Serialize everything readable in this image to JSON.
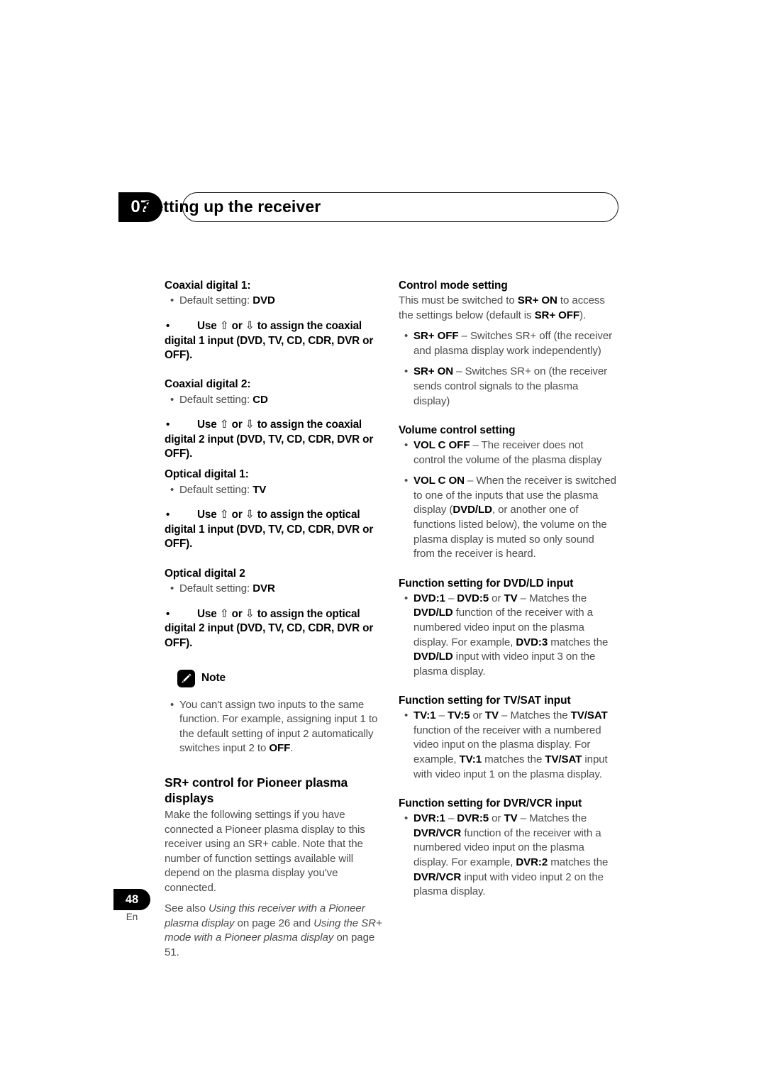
{
  "header": {
    "chapter_number": "07",
    "title": "Setting up the receiver"
  },
  "footer": {
    "page_number": "48",
    "language": "En"
  },
  "left_column": {
    "coaxial1": {
      "heading": "Coaxial digital 1:",
      "default": "Default setting: ",
      "default_value": "DVD",
      "instruction_pre": "Use ",
      "instruction_mid": " or ",
      "instruction_post": " to assign the coaxial digital 1 input (DVD, TV, CD, CDR, DVR or OFF)."
    },
    "coaxial2": {
      "heading": "Coaxial digital 2:",
      "default": "Default setting: ",
      "default_value": "CD",
      "instruction_pre": "Use ",
      "instruction_mid": " or ",
      "instruction_post": " to assign the coaxial digital 2 input (DVD, TV, CD, CDR, DVR or OFF)."
    },
    "optical1": {
      "heading": "Optical digital 1:",
      "default": "Default setting: ",
      "default_value": "TV",
      "instruction_pre": "Use ",
      "instruction_mid": " or ",
      "instruction_post": " to assign the optical digital 1 input (DVD, TV, CD, CDR, DVR or OFF)."
    },
    "optical2": {
      "heading": "Optical digital 2",
      "default": "Default setting: ",
      "default_value": "DVR",
      "instruction_pre": "Use ",
      "instruction_mid": " or ",
      "instruction_post": " to assign the optical digital 2 input (DVD, TV, CD, CDR, DVR or OFF)."
    },
    "note": {
      "label": "Note",
      "icon": "pencil-icon",
      "text_part1": "You can't assign two inputs to the same function. For example, assigning input 1 to the default setting of input 2 automatically switches input 2 to ",
      "text_bold": "OFF",
      "text_part2": "."
    },
    "srplus": {
      "heading": "SR+ control for Pioneer plasma displays",
      "body": "Make the following settings if you have connected a Pioneer plasma display to this receiver using an SR+ cable. Note that the number of function settings available will depend on the plasma display you've connected.",
      "seealso_pre": "See also ",
      "seealso_italic1": "Using this receiver with a Pioneer plasma display",
      "seealso_mid1": " on page 26 and ",
      "seealso_italic2": "Using the SR+ mode with a Pioneer plasma display",
      "seealso_mid2": " on page 51."
    }
  },
  "right_column": {
    "control_mode": {
      "heading": "Control mode setting",
      "intro_part1": "This must be switched to ",
      "intro_bold1": "SR+ ON",
      "intro_part2": " to access the settings below (default is ",
      "intro_bold2": "SR+ OFF",
      "intro_part3": ").",
      "bullets": [
        {
          "term": "SR+ OFF",
          "desc": " – Switches SR+ off (the receiver and plasma display work independently)"
        },
        {
          "term": "SR+ ON",
          "desc": " – Switches SR+ on (the receiver sends control signals to the plasma display)"
        }
      ]
    },
    "volume_control": {
      "heading": "Volume control setting",
      "bullet1_term": "VOL C OFF",
      "bullet1_desc": " – The receiver does not control the volume of the plasma display",
      "bullet2_term": "VOL C ON",
      "bullet2_part1": " – When the receiver is switched to one of the inputs that use the plasma display (",
      "bullet2_bold": "DVD/LD",
      "bullet2_part2": ", or another one of functions listed below), the volume on the plasma display is muted so only sound from the receiver is heard."
    },
    "dvdld": {
      "heading": "Function setting for DVD/LD input",
      "range_start": "DVD:1",
      "range_dash": " – ",
      "range_end": "DVD:5",
      "range_or": " or ",
      "range_tv": "TV",
      "desc_part1": " – Matches the ",
      "desc_bold1": "DVD/LD",
      "desc_part2": " function of the receiver with a numbered video input on the plasma display. For example, ",
      "desc_bold2": "DVD:3",
      "desc_part3": " matches the ",
      "desc_bold3": "DVD/LD",
      "desc_part4": " input with video input 3 on the plasma display."
    },
    "tvsat": {
      "heading": "Function setting for TV/SAT input",
      "range_start": "TV:1",
      "range_dash": " – ",
      "range_end": "TV:5",
      "range_or": " or ",
      "range_tv": "TV",
      "desc_part1": " – Matches the ",
      "desc_bold1": "TV/SAT",
      "desc_part2": " function of the receiver with a numbered video input on the plasma display. For example, ",
      "desc_bold2": "TV:1",
      "desc_part3": " matches the ",
      "desc_bold3": "TV/SAT",
      "desc_part4": " input with video input 1 on the plasma display."
    },
    "dvrvcr": {
      "heading": "Function setting for DVR/VCR input",
      "range_start": "DVR:1",
      "range_dash": " – ",
      "range_end": "DVR:5",
      "range_or": " or ",
      "range_tv": "TV",
      "desc_part1": " – Matches the ",
      "desc_bold1": "DVR/VCR",
      "desc_part2": " function of the receiver with a numbered video input on the plasma display. For example, ",
      "desc_bold2": "DVR:2",
      "desc_part3": " matches the ",
      "desc_bold3": "DVR/VCR",
      "desc_part4": " input with video input 2 on the plasma display."
    }
  },
  "glyphs": {
    "arrow_up": "⇧",
    "arrow_down": "⇩"
  }
}
